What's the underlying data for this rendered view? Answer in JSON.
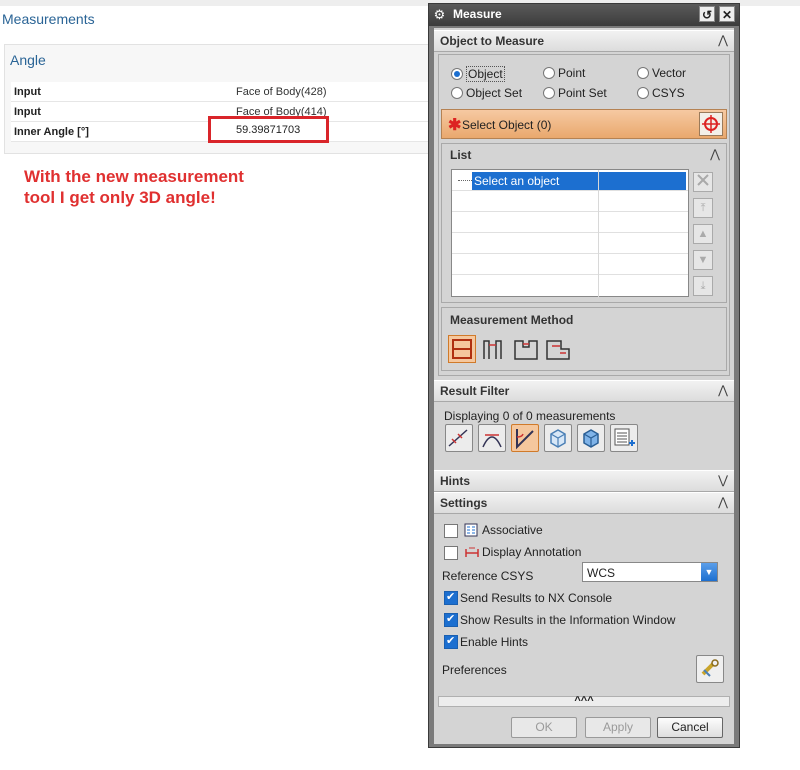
{
  "page": {
    "title": "Measurements",
    "section_title": "Angle",
    "rows": [
      {
        "label": "Input",
        "value": "Face of Body(428)"
      },
      {
        "label": "Input",
        "value": "Face of Body(414)"
      },
      {
        "label": "Inner Angle [°]",
        "value": "59.39871703"
      }
    ],
    "annotation_line1": "With the new measurement",
    "annotation_line2": "tool I get only 3D angle!"
  },
  "dialog": {
    "title": "Measure",
    "title_buttons": {
      "reset": "↺",
      "close": "✕"
    },
    "object_to_measure": {
      "header": "Object to Measure",
      "radios": [
        {
          "label": "Object",
          "selected": true
        },
        {
          "label": "Point",
          "selected": false
        },
        {
          "label": "Vector",
          "selected": false
        },
        {
          "label": "Object Set",
          "selected": false
        },
        {
          "label": "Point Set",
          "selected": false
        },
        {
          "label": "CSYS",
          "selected": false
        }
      ],
      "select_object": "Select Object (0)",
      "required_mark": "✱"
    },
    "list": {
      "header": "List",
      "selected_item": "Select an object"
    },
    "measurement_method": {
      "header": "Measurement Method"
    },
    "result_filter": {
      "header": "Result Filter",
      "status": "Displaying 0 of 0 measurements"
    },
    "hints": {
      "header": "Hints"
    },
    "settings": {
      "header": "Settings",
      "associative": "Associative",
      "display_annotation": "Display Annotation",
      "reference_csys_label": "Reference CSYS",
      "reference_csys_value": "WCS",
      "send_results": "Send Results to NX Console",
      "show_results": "Show Results in the Information Window",
      "enable_hints": "Enable Hints",
      "preferences": "Preferences"
    },
    "more": "^^^",
    "buttons": {
      "ok": "OK",
      "apply": "Apply",
      "cancel": "Cancel"
    },
    "chevron_up": "⋀",
    "chevron_down": "⋁"
  },
  "colors": {
    "accent": "#1c6fd0",
    "highlight_red": "#d9252a",
    "annotation_red": "#e03030",
    "select_orange": "#e9a86d"
  }
}
